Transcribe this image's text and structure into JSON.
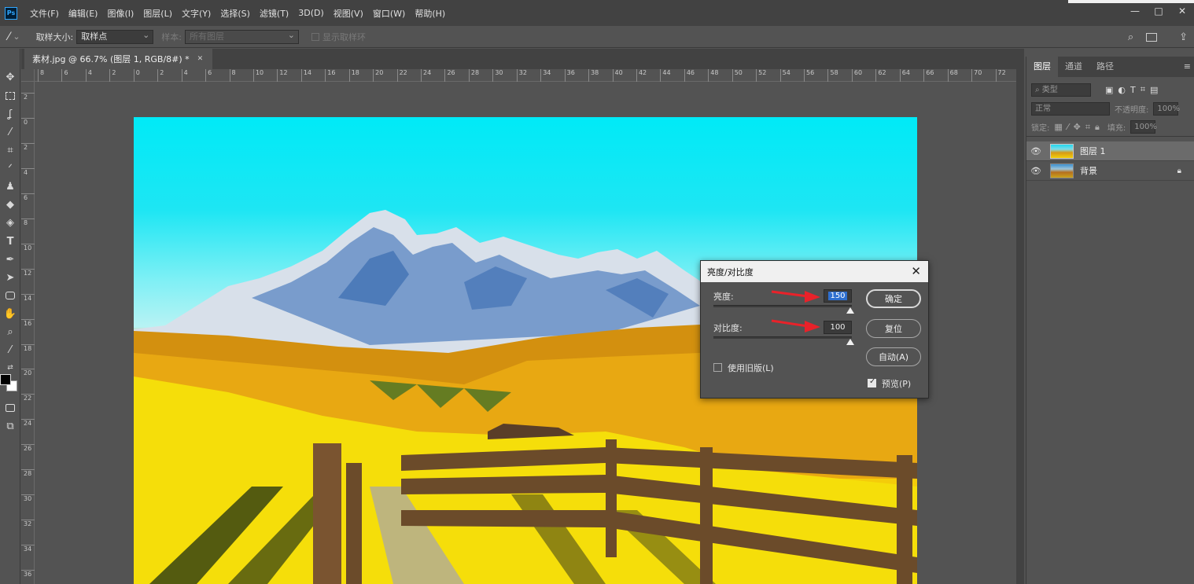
{
  "menu": {
    "logo": "Ps",
    "items": [
      "文件(F)",
      "编辑(E)",
      "图像(I)",
      "图层(L)",
      "文字(Y)",
      "选择(S)",
      "滤镜(T)",
      "3D(D)",
      "视图(V)",
      "窗口(W)",
      "帮助(H)"
    ]
  },
  "window_controls": {
    "minimize": "—",
    "maximize": "□",
    "close": "✕"
  },
  "options_bar": {
    "sample_size_label": "取样大小:",
    "sample_size_value": "取样点",
    "sample_label": "样本:",
    "sample_value": "所有图层",
    "show_ring_label": "显示取样环"
  },
  "document": {
    "tab_title": "素材.jpg @ 66.7% (图层 1, RGB/8#) *",
    "tab_close": "✕"
  },
  "ruler_top": [
    "8",
    "6",
    "4",
    "2",
    "0",
    "2",
    "4",
    "6",
    "8",
    "10",
    "12",
    "14",
    "16",
    "18",
    "20",
    "22",
    "24",
    "26",
    "28",
    "30",
    "32",
    "34",
    "36",
    "38",
    "40",
    "42",
    "44",
    "46",
    "48",
    "50",
    "52",
    "54",
    "56",
    "58",
    "60",
    "62",
    "64",
    "66",
    "68",
    "70",
    "72"
  ],
  "ruler_left": [
    "2",
    "0",
    "2",
    "4",
    "6",
    "8",
    "10",
    "12",
    "14",
    "16",
    "18",
    "20",
    "22",
    "24",
    "26",
    "28",
    "30",
    "32",
    "34",
    "36"
  ],
  "layers_panel": {
    "tabs": [
      "图层",
      "通道",
      "路径"
    ],
    "filter_placeholder": "类型",
    "blend_mode": "正常",
    "opacity_label": "不透明度:",
    "opacity_value": "100%",
    "lock_label": "锁定:",
    "fill_label": "填充:",
    "fill_value": "100%",
    "layers": [
      {
        "name": "图层 1",
        "selected": true
      },
      {
        "name": "背景",
        "selected": false,
        "locked": true
      }
    ]
  },
  "dialog": {
    "title": "亮度/对比度",
    "brightness_label": "亮度:",
    "brightness_value": "150",
    "contrast_label": "对比度:",
    "contrast_value": "100",
    "legacy_label": "使用旧版(L)",
    "legacy_checked": false,
    "preview_label": "预览(P)",
    "preview_checked": true,
    "ok_label": "确定",
    "reset_label": "复位",
    "auto_label": "自动(A)",
    "close": "✕"
  },
  "colors": {
    "annotation_arrow": "#e8222a",
    "selection_blue": "#2e6fd0"
  }
}
